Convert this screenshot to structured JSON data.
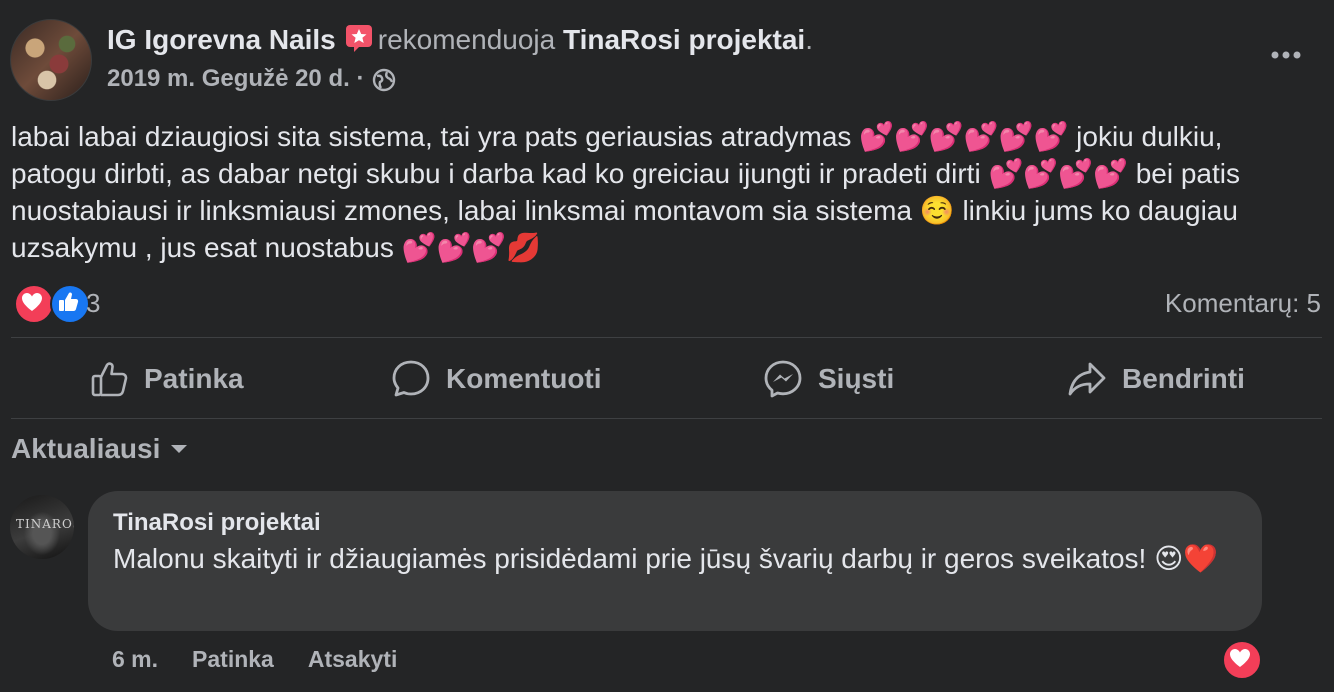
{
  "post": {
    "author": "IG Igorevna Nails",
    "recommends_text": "rekomenduoja",
    "page_name": "TinaRosi projektai",
    "period": ".",
    "date": "2019 m. Gegužė 20 d.",
    "separator": "·",
    "text": "labai labai dziaugiosi sita sistema, tai yra pats geriausias atradymas 💕💕💕💕💕💕 jokiu dulkiu, patogu dirbti, as dabar netgi skubu i darba kad ko greiciau ijungti ir pradeti dirti 💕💕💕💕 bei patis nuostabiausi ir linksmiausi zmones, labai linksmai montavom sia sistema ☺️ linkiu jums ko daugiau uzsakymu , jus esat nuostabus 💕💕💕💋",
    "reaction_count": "3",
    "comments_count": "Komentarų: 5"
  },
  "actions": {
    "like": "Patinka",
    "comment": "Komentuoti",
    "send": "Siųsti",
    "share": "Bendrinti"
  },
  "sort": {
    "label": "Aktualiausi"
  },
  "comment": {
    "author": "TinaRosi projektai",
    "avatar_text": "TINAROSI",
    "text": "Malonu skaityti ir džiaugiamės prisidėdami prie jūsų švarių darbų ir geros sveikatos! 😍❤️",
    "time": "6 m.",
    "like": "Patinka",
    "reply": "Atsakyti"
  },
  "colors": {
    "background": "#242526",
    "bubble": "#3a3b3c",
    "text_primary": "#e4e6eb",
    "text_secondary": "#b0b3b8",
    "love": "#f33e58",
    "like": "#1877f2",
    "recommend": "#f35369"
  },
  "icons": [
    "recommend-star-icon",
    "globe-icon",
    "more-options-icon",
    "love-reaction-icon",
    "like-reaction-icon",
    "thumbs-up-icon",
    "comment-bubble-icon",
    "messenger-icon",
    "share-arrow-icon",
    "caret-down-icon"
  ]
}
